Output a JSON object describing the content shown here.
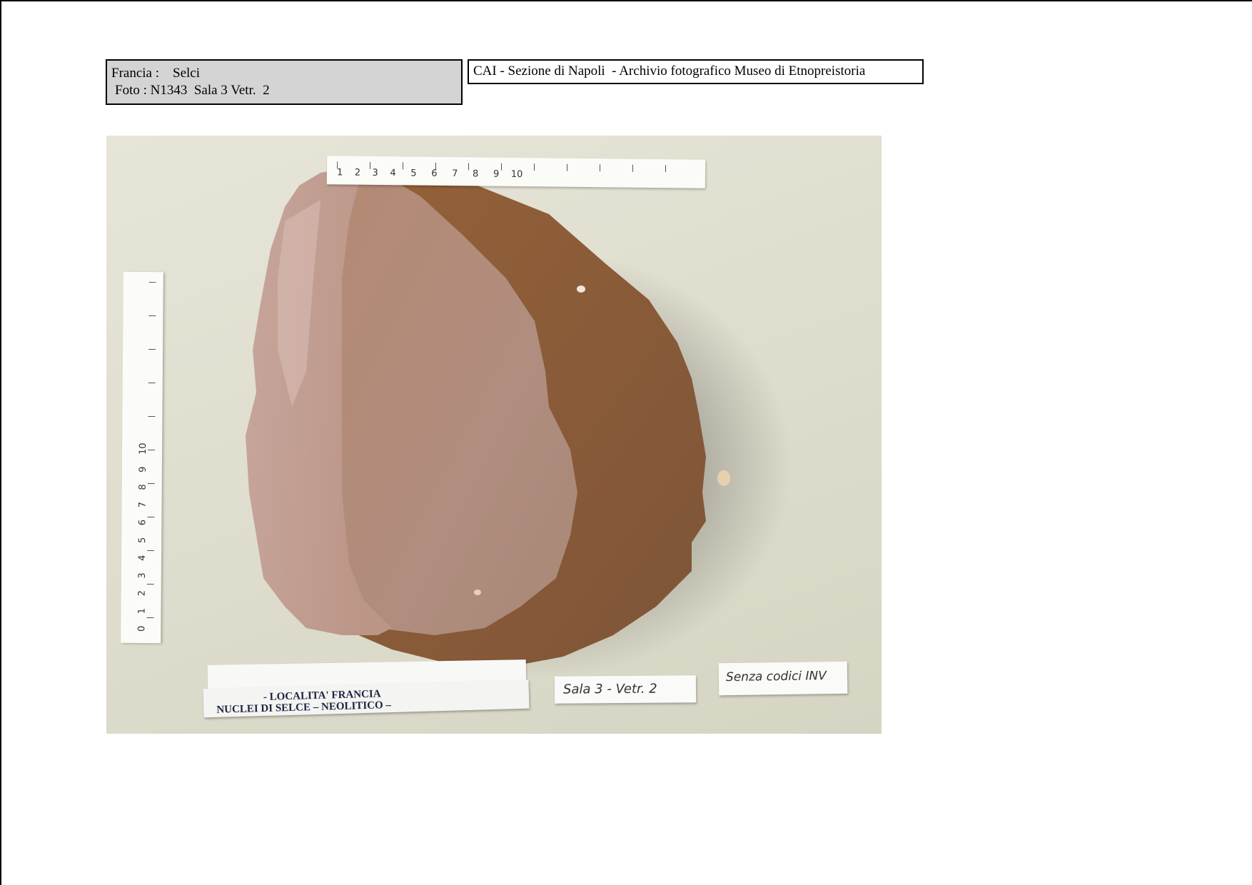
{
  "header": {
    "label_line1": "Francia :    Selci",
    "label_line2": "Foto : N1343  Sala 3 Vetr.  2",
    "archive": "CAI - Sezione di Napoli  - Archivio fotografico Museo di Etnopreistoria"
  },
  "photo": {
    "ruler_h_numbers": "1    2    3    4     5     6     7     8     9    10",
    "ruler_v_numbers": "0    1    2    3    4    5    6    7    8    9    10",
    "card_location_line1": "- LOCALITA' FRANCIA",
    "card_location_line2": "NUCLEI DI SELCE – NEOLITICO –",
    "card_sala": "Sala 3 - Vetr. 2",
    "card_inventory": "Senza codici INV"
  },
  "colors": {
    "label_fill": "#d4d4d4",
    "background": "#e3e1d3",
    "flint_brown": "#8e5f3a",
    "flint_light": "#c9a89c"
  }
}
